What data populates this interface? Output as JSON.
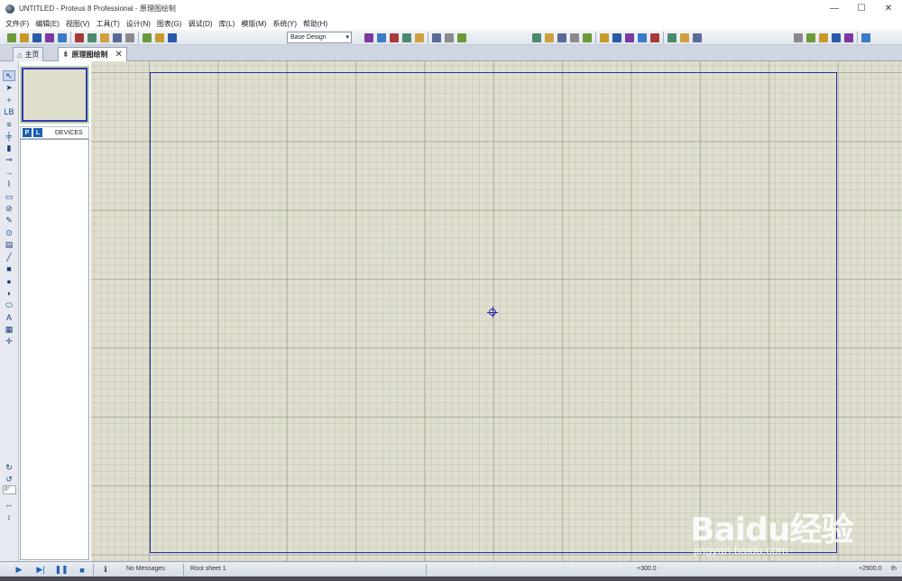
{
  "window": {
    "title": "UNTITLED - Proteus 8 Professional - 原理图绘制",
    "minimize": "—",
    "maximize": "☐",
    "close": "✕"
  },
  "menu": [
    "文件(F)",
    "编辑(E)",
    "视图(V)",
    "工具(T)",
    "设计(N)",
    "图表(G)",
    "调试(D)",
    "库(L)",
    "模版(M)",
    "系统(Y)",
    "帮助(H)"
  ],
  "toolbar": {
    "variant": "Base Design",
    "groups": [
      {
        "icons": [
          "new-icon",
          "open-icon",
          "save-icon",
          "import-icon",
          "home-icon",
          "pcb-icon",
          "schematic-icon",
          "simulator-icon",
          "design-explorer-icon",
          "bom-icon",
          "gerber-icon",
          "notes-icon",
          "help-icon"
        ]
      },
      {
        "icons": [
          "refresh-icon",
          "grid-icon",
          "origin-icon",
          "pan-icon",
          "zoom-in-icon",
          "zoom-out-icon",
          "zoom-all-icon",
          "zoom-area-icon"
        ]
      },
      {
        "icons": [
          "undo-icon",
          "redo-icon",
          "cut-icon",
          "copy-icon",
          "paste-icon",
          "block-copy-icon",
          "block-move-icon",
          "block-rotate-icon",
          "block-delete-icon",
          "pick-device-icon",
          "make-device-icon",
          "package-icon",
          "decompose-icon"
        ]
      },
      {
        "icons": [
          "wire-autorouter-icon",
          "search-icon",
          "property-tool-icon",
          "new-sheet-icon",
          "remove-sheet-icon",
          "exit-to-parent-icon"
        ]
      }
    ],
    "colors": [
      "#6a9a3a",
      "#c89a2a",
      "#2a5aa8",
      "#7a3aa0",
      "#3a7ac8",
      "#a83a3a",
      "#4a8a6a",
      "#d0a040",
      "#5a6a9a",
      "#8a8a8a"
    ]
  },
  "tabs": [
    {
      "label": "主页",
      "icon": "home-icon"
    },
    {
      "label": "原理图绘制",
      "icon": "schematic-icon",
      "close": "✕"
    }
  ],
  "modebar": {
    "icons": [
      "selection-mode-icon",
      "component-mode-icon",
      "junction-dot-icon",
      "wire-label-icon",
      "text-script-icon",
      "buses-icon",
      "subcircuit-icon",
      "terminals-icon",
      "device-pins-icon",
      "graph-icon",
      "tape-recorder-icon",
      "generator-icon",
      "voltage-probe-icon",
      "current-probe-icon",
      "virtual-instruments-icon",
      "line-icon",
      "box-icon",
      "circle-icon",
      "arc-icon",
      "closed-path-icon",
      "text-icon",
      "symbol-icon",
      "marker-icon"
    ],
    "glyphs": [
      "↖",
      "➤",
      "+",
      "LB",
      "≡",
      "╪",
      "▮",
      "⇒",
      "→",
      "⌇",
      "▭",
      "⊘",
      "✎",
      "⊙",
      "▤",
      "╱",
      "■",
      "●",
      "◗",
      "⬭",
      "A",
      "▦",
      "✛"
    ],
    "rotate_cw": "↻",
    "rotate_ccw": "↺",
    "rotation": "0°",
    "mirror_h": "↔",
    "mirror_v": "↕"
  },
  "device_panel": {
    "p_button": "P",
    "l_button": "L",
    "header": "DEVICES"
  },
  "status": {
    "messages": "No Messages",
    "sheet": "Root sheet 1",
    "x_coord": "+300.0",
    "y_coord": "+2900.0",
    "units": "th",
    "play": "▶",
    "step": "▶|",
    "pause": "❚❚",
    "stop": "■",
    "info": "ℹ"
  },
  "watermark": {
    "main": "Baidu经验",
    "sub": "jingyan.baidu.com"
  }
}
